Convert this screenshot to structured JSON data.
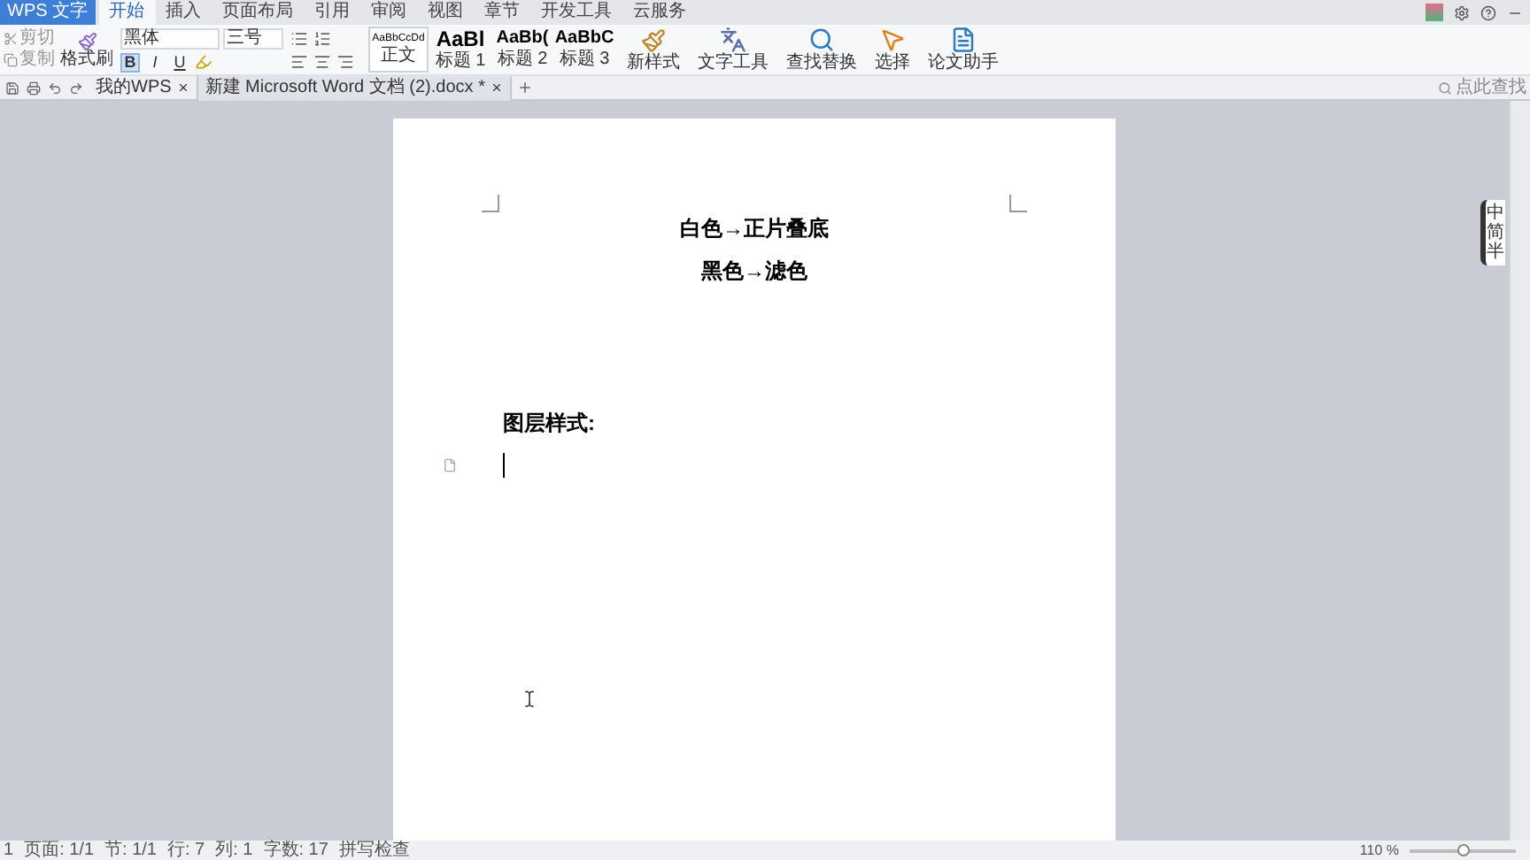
{
  "app_button": {
    "label": "WPS 文字"
  },
  "menu_tabs": [
    {
      "label": "开始",
      "selected": true
    },
    {
      "label": "插入",
      "selected": false
    },
    {
      "label": "页面布局",
      "selected": false
    },
    {
      "label": "引用",
      "selected": false
    },
    {
      "label": "审阅",
      "selected": false
    },
    {
      "label": "视图",
      "selected": false
    },
    {
      "label": "章节",
      "selected": false
    },
    {
      "label": "开发工具",
      "selected": false
    },
    {
      "label": "云服务",
      "selected": false
    }
  ],
  "clipboard": {
    "cut": "剪切",
    "copy": "复制",
    "format_painter": "格式刷"
  },
  "font": {
    "name": "黑体",
    "size": "三号"
  },
  "format_buttons": [
    {
      "label": "B",
      "selected": true
    },
    {
      "label": "I",
      "selected": false
    },
    {
      "label": "U",
      "selected": false
    }
  ],
  "styles": [
    {
      "preview": "AaBbCcDd",
      "label": "正文",
      "selected": true,
      "kind": "small"
    },
    {
      "preview": "AaBl",
      "label": "标题 1",
      "selected": false,
      "kind": "large"
    },
    {
      "preview": "AaBb(",
      "label": "标题 2",
      "selected": false,
      "kind": "medium"
    },
    {
      "preview": "AaBbC",
      "label": "标题 3",
      "selected": false,
      "kind": "medium"
    }
  ],
  "ribbon_buttons": [
    {
      "label": "新样式",
      "kind": "style"
    },
    {
      "label": "文字工具",
      "kind": "text"
    },
    {
      "label": "查找替换",
      "kind": "find"
    },
    {
      "label": "选择",
      "kind": "select"
    },
    {
      "label": "论文助手",
      "kind": "paper"
    }
  ],
  "doc_tabs": [
    {
      "label": "我的WPS",
      "selected": false
    },
    {
      "label": "新建 Microsoft Word 文档 (2).docx *",
      "selected": true
    }
  ],
  "search": {
    "placeholder": "点此查找"
  },
  "document": {
    "centered_lines": [
      "白色→正片叠底",
      "黑色→滤色"
    ],
    "heading": "图层样式:"
  },
  "ime": [
    "中",
    "简",
    "半"
  ],
  "status_bar": [
    "1",
    "页面: 1/1",
    "节: 1/1",
    "行: 7",
    "列: 1",
    "字数: 17",
    "拼写检查"
  ],
  "zoom": {
    "label": "110 %",
    "level": 0.5
  }
}
